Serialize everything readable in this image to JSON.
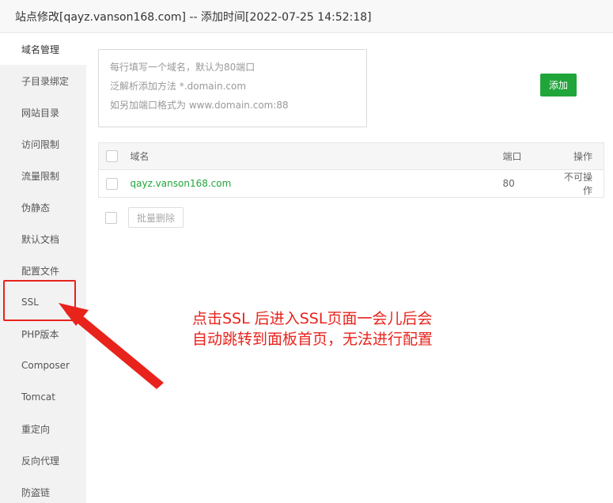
{
  "window": {
    "title": "站点修改[qayz.vanson168.com] -- 添加时间[2022-07-25 14:52:18]"
  },
  "sidebar": {
    "items": [
      {
        "label": "域名管理"
      },
      {
        "label": "子目录绑定"
      },
      {
        "label": "网站目录"
      },
      {
        "label": "访问限制"
      },
      {
        "label": "流量限制"
      },
      {
        "label": "伪静态"
      },
      {
        "label": "默认文档"
      },
      {
        "label": "配置文件"
      },
      {
        "label": "SSL"
      },
      {
        "label": "PHP版本"
      },
      {
        "label": "Composer"
      },
      {
        "label": "Tomcat"
      },
      {
        "label": "重定向"
      },
      {
        "label": "反向代理"
      },
      {
        "label": "防盗链"
      }
    ],
    "active_index": 0
  },
  "domain_form": {
    "placeholder": "每行填写一个域名，默认为80端口\n泛解析添加方法 *.domain.com\n如另加端口格式为 www.domain.com:88",
    "add_label": "添加"
  },
  "table": {
    "headers": {
      "domain": "域名",
      "port": "端口",
      "operation": "操作"
    },
    "rows": [
      {
        "domain": "qayz.vanson168.com",
        "port": "80",
        "operation": "不可操作"
      }
    ]
  },
  "bulk": {
    "delete_label": "批量删除"
  },
  "annotation": {
    "lines": [
      "点击SSL 后进入SSL页面一会儿后会",
      "自动跳转到面板首页，无法进行配置"
    ]
  },
  "colors": {
    "accent": "#20a53a",
    "annotation": "#e8231c"
  }
}
